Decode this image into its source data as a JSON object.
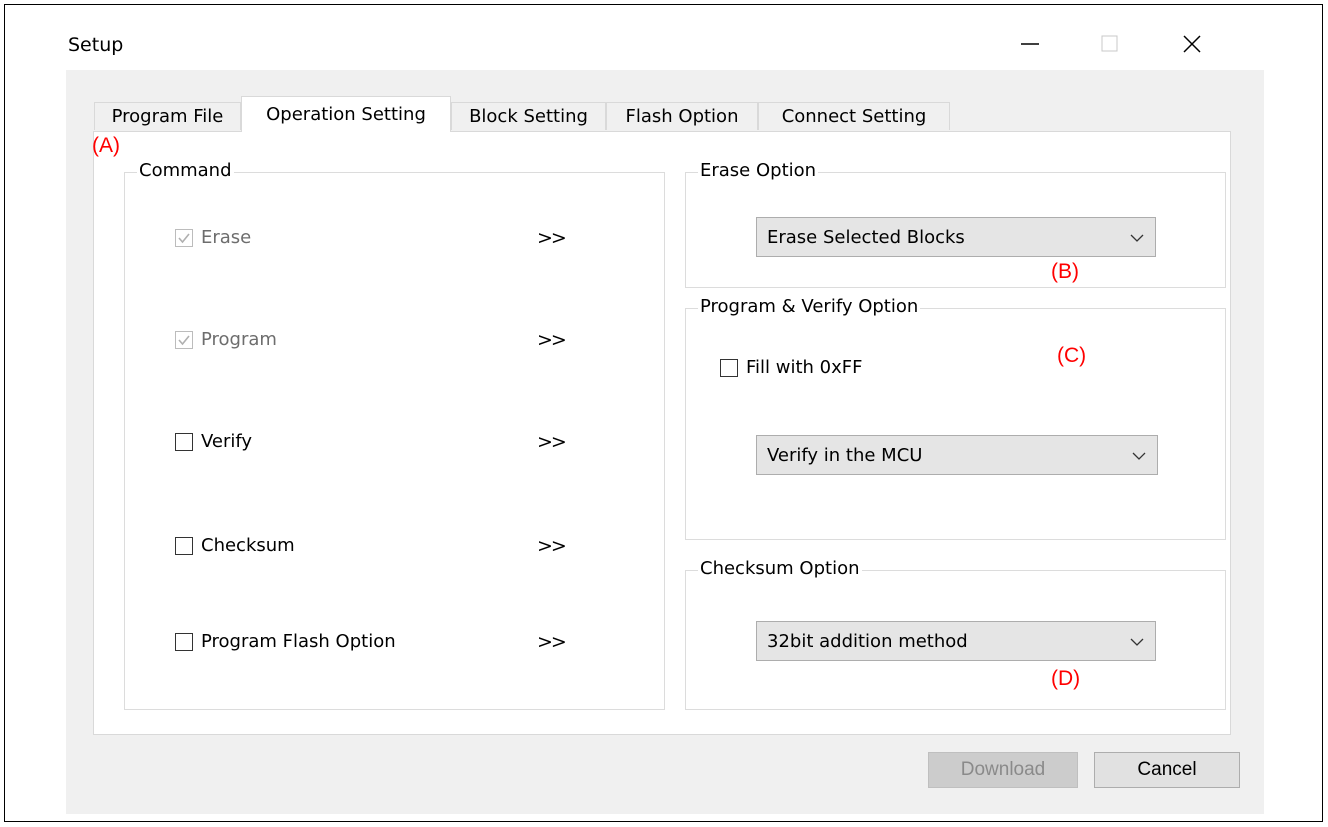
{
  "window": {
    "title": "Setup"
  },
  "tabs": [
    {
      "label": "Program File",
      "active": false
    },
    {
      "label": "Operation Setting",
      "active": true
    },
    {
      "label": "Block Setting",
      "active": false
    },
    {
      "label": "Flash Option",
      "active": false
    },
    {
      "label": "Connect Setting",
      "active": false
    }
  ],
  "command": {
    "label": "Command",
    "items": [
      {
        "label": "Erase",
        "checked": true,
        "enabled": false,
        "arrow": ">>"
      },
      {
        "label": "Program",
        "checked": true,
        "enabled": false,
        "arrow": ">>"
      },
      {
        "label": "Verify",
        "checked": false,
        "enabled": true,
        "arrow": ">>"
      },
      {
        "label": "Checksum",
        "checked": false,
        "enabled": true,
        "arrow": ">>"
      },
      {
        "label": "Program Flash Option",
        "checked": false,
        "enabled": true,
        "arrow": ">>"
      }
    ]
  },
  "erase_option": {
    "label": "Erase Option",
    "value": "Erase Selected Blocks"
  },
  "program_verify_option": {
    "label": "Program & Verify Option",
    "fill_label": "Fill with 0xFF",
    "fill_checked": false,
    "verify_value": "Verify in the MCU"
  },
  "checksum_option": {
    "label": "Checksum Option",
    "value": "32bit addition method"
  },
  "markers": {
    "a": "(A)",
    "b": "(B)",
    "c": "(C)",
    "d": "(D)"
  },
  "buttons": {
    "download": "Download",
    "cancel": "Cancel"
  },
  "colors": {
    "marker": "#ff0000",
    "window_bg": "#f0f0f0",
    "panel_bg": "#ffffff"
  }
}
